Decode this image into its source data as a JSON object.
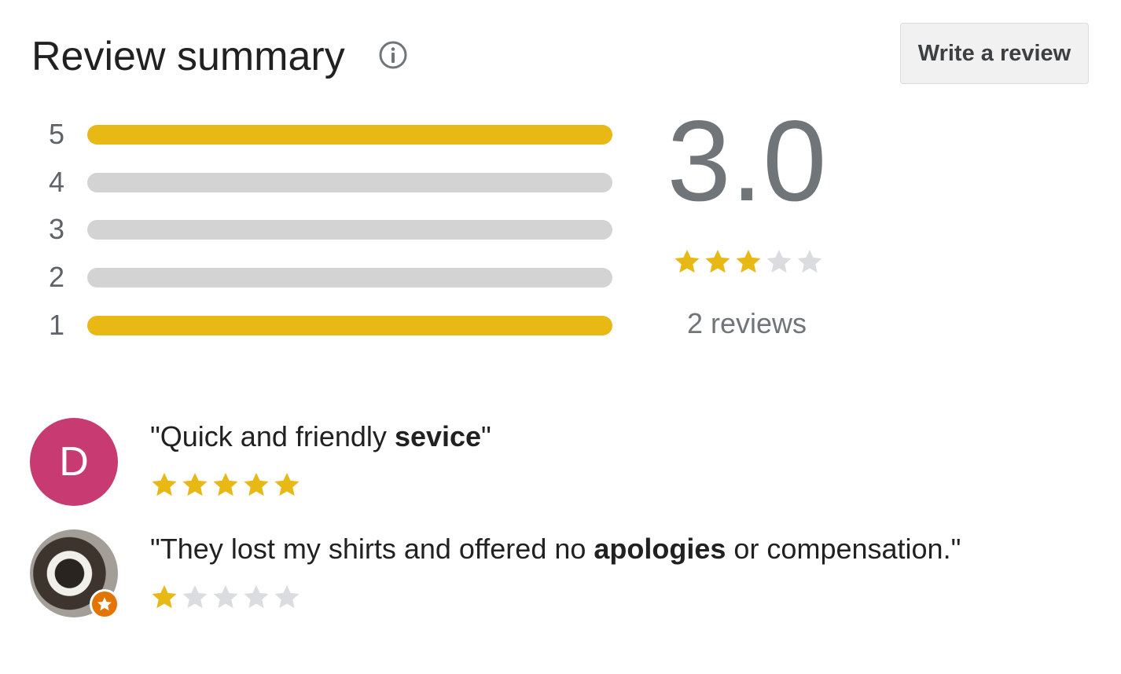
{
  "header": {
    "title": "Review summary",
    "write_review_label": "Write a review"
  },
  "histogram": [
    {
      "label": "5",
      "fraction": 1.0
    },
    {
      "label": "4",
      "fraction": 0.0
    },
    {
      "label": "3",
      "fraction": 0.0
    },
    {
      "label": "2",
      "fraction": 0.0
    },
    {
      "label": "1",
      "fraction": 1.0
    }
  ],
  "summary": {
    "average": "3.0",
    "rating": 3,
    "count_label": "2 reviews"
  },
  "reviews": [
    {
      "avatar_letter": "D",
      "avatar_type": "letter",
      "quote_open": "\"",
      "text_before": "Quick and friendly ",
      "bold": "sevice",
      "text_after": "",
      "quote_close": "\"",
      "rating": 5
    },
    {
      "avatar_letter": "",
      "avatar_type": "photo",
      "quote_open": "\"",
      "text_before": "They lost my shirts and offered no ",
      "bold": "apologies",
      "text_after": " or compensation.",
      "quote_close": "\"",
      "rating": 1
    }
  ],
  "colors": {
    "star_on": "#e8b914",
    "star_off": "#dadce0",
    "bar_fill": "#e8b914",
    "bar_track": "#d3d3d3",
    "avatar_letter_bg": "#c73b72",
    "badge": "#e37400"
  },
  "icons": {
    "info": "info-icon",
    "star": "star-icon",
    "badge": "local-guide-badge-icon"
  }
}
